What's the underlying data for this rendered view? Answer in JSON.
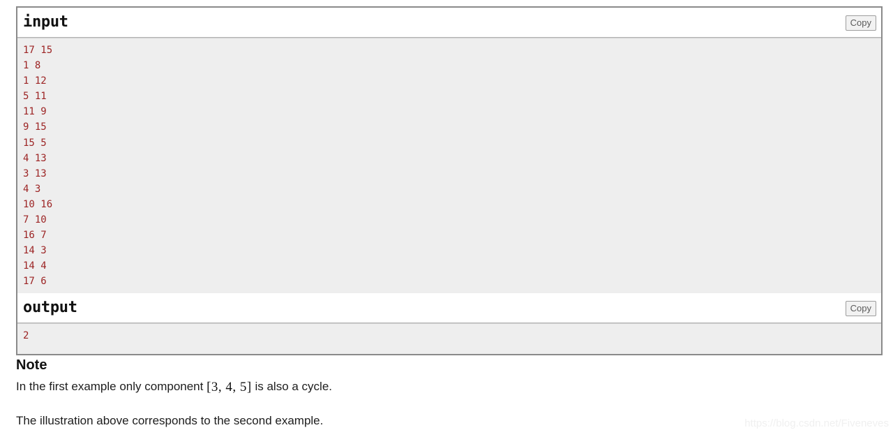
{
  "sample_tests": {
    "input": {
      "title": "input",
      "copy_label": "Copy",
      "lines": [
        "17 15",
        "1 8",
        "1 12",
        "5 11",
        "11 9",
        "9 15",
        "15 5",
        "4 13",
        "3 13",
        "4 3",
        "10 16",
        "7 10",
        "16 7",
        "14 3",
        "14 4",
        "17 6"
      ]
    },
    "output": {
      "title": "output",
      "copy_label": "Copy",
      "lines": [
        "2"
      ]
    }
  },
  "note": {
    "heading": "Note",
    "paragraph_1_prefix": "In the first example only component ",
    "paragraph_1_math": "[3, 4, 5]",
    "paragraph_1_suffix": " is also a cycle.",
    "paragraph_2": "The illustration above corresponds to the second example."
  },
  "watermark": {
    "text": "https://blog.csdn.net/Fiveneves"
  },
  "colors": {
    "data_text": "#9c2424",
    "panel_border": "#8a8a8a",
    "data_background": "#eeeeee",
    "header_background": "#ffffff",
    "watermark_text": "#f0f0f0"
  }
}
